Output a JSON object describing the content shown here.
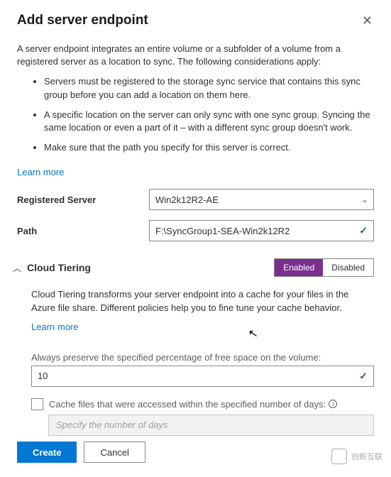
{
  "header": {
    "title": "Add server endpoint"
  },
  "intro": {
    "text": "A server endpoint integrates an entire volume or a subfolder of a volume from a registered server as a location to sync. The following considerations apply:",
    "bullets": [
      "Servers must be registered to the storage sync service that contains this sync group before you can add a location on them here.",
      "A specific location on the server can only sync with one sync group. Syncing the same location or even a part of it – with a different sync group doesn't work.",
      "Make sure that the path you specify for this server is correct."
    ],
    "learn_more": "Learn more"
  },
  "fields": {
    "server_label": "Registered Server",
    "server_value": "Win2k12R2-AE",
    "path_label": "Path",
    "path_value": "F:\\SyncGroup1-SEA-Win2k12R2"
  },
  "tiering": {
    "title": "Cloud Tiering",
    "enabled_label": "Enabled",
    "disabled_label": "Disabled",
    "description": "Cloud Tiering transforms your server endpoint into a cache for your files in the Azure file share. Different policies help you to fine tune your cache behavior.",
    "learn_more": "Learn more",
    "free_space_label": "Always preserve the specified percentage of free space on the volume:",
    "free_space_value": "10",
    "cache_days_label": "Cache files that were accessed within the specified number of days:",
    "cache_days_placeholder": "Specify the number of days"
  },
  "buttons": {
    "create": "Create",
    "cancel": "Cancel"
  },
  "watermark": {
    "text": "创新互联"
  }
}
